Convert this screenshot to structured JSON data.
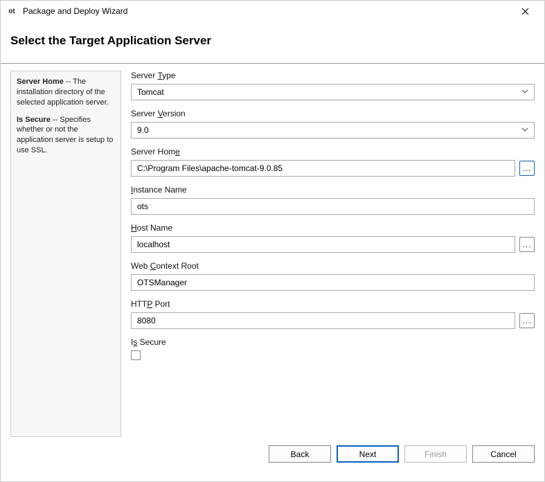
{
  "window": {
    "title": "Package and Deploy Wizard",
    "app_icon_text": "ot"
  },
  "header": {
    "title": "Select the Target Application Server"
  },
  "side": {
    "server_home_label": "Server Home",
    "server_home_desc": " -- The installation directory of the selected application server.",
    "is_secure_label": "Is Secure",
    "is_secure_desc": " -- Specifies whether or not the application server is setup to use SSL."
  },
  "fields": {
    "server_type": {
      "label_pre": "Server ",
      "label_mn": "T",
      "label_post": "ype",
      "value": "Tomcat"
    },
    "server_version": {
      "label_pre": "Server ",
      "label_mn": "V",
      "label_post": "ersion",
      "value": "9.0"
    },
    "server_home": {
      "label_pre": "Server Hom",
      "label_mn": "e",
      "label_post": "",
      "value": "C:\\Program Files\\apache-tomcat-9.0.85"
    },
    "instance_name": {
      "label_pre": "",
      "label_mn": "I",
      "label_post": "nstance Name",
      "value": "ots"
    },
    "host_name": {
      "label_pre": "",
      "label_mn": "H",
      "label_post": "ost Name",
      "value": "localhost"
    },
    "web_context_root": {
      "label_pre": "Web ",
      "label_mn": "C",
      "label_post": "ontext Root",
      "value": "OTSManager"
    },
    "http_port": {
      "label_pre": "HTT",
      "label_mn": "P",
      "label_post": " Port",
      "value": "8080"
    },
    "is_secure": {
      "label_pre": "I",
      "label_mn": "s",
      "label_post": " Secure",
      "checked": false
    }
  },
  "buttons": {
    "browse": "...",
    "back": "Back",
    "next": "Next",
    "finish": "Finish",
    "cancel": "Cancel"
  }
}
